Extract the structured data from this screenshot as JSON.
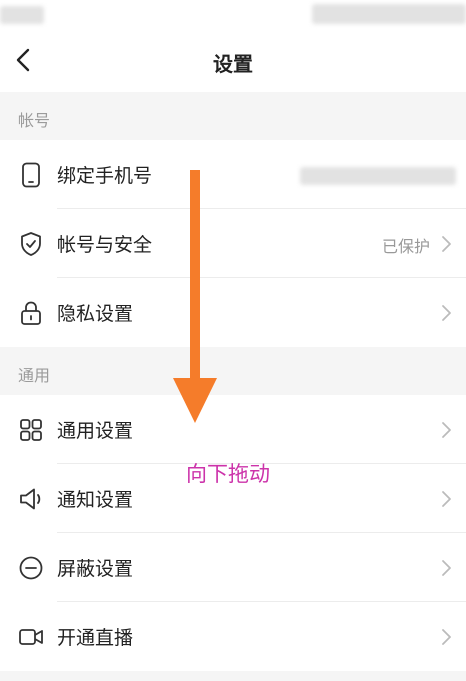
{
  "header": {
    "title": "设置"
  },
  "sections": [
    {
      "title": "帐号",
      "items": [
        {
          "label": "绑定手机号",
          "value": "",
          "icon": "phone-icon"
        },
        {
          "label": "帐号与安全",
          "value": "已保护",
          "icon": "shield-icon"
        },
        {
          "label": "隐私设置",
          "value": "",
          "icon": "lock-icon"
        }
      ]
    },
    {
      "title": "通用",
      "items": [
        {
          "label": "通用设置",
          "value": "",
          "icon": "grid-icon"
        },
        {
          "label": "通知设置",
          "value": "",
          "icon": "speaker-icon"
        },
        {
          "label": "屏蔽设置",
          "value": "",
          "icon": "block-icon"
        },
        {
          "label": "开通直播",
          "value": "",
          "icon": "video-camera-icon"
        }
      ]
    }
  ],
  "annotation": {
    "text": "向下拖动",
    "color": "#cc33aa",
    "arrow_color": "#f57c2a"
  }
}
